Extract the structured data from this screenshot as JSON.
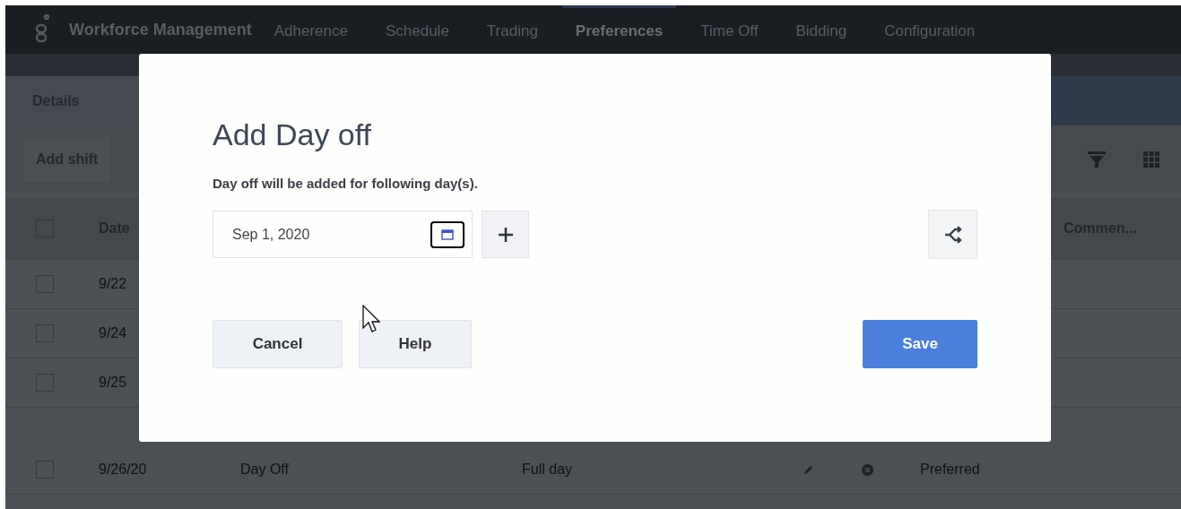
{
  "nav": {
    "app_title": "Workforce Management",
    "tabs": [
      {
        "label": "Adherence",
        "selected": false
      },
      {
        "label": "Schedule",
        "selected": false
      },
      {
        "label": "Trading",
        "selected": false
      },
      {
        "label": "Preferences",
        "selected": true
      },
      {
        "label": "Time Off",
        "selected": false
      },
      {
        "label": "Bidding",
        "selected": false
      },
      {
        "label": "Configuration",
        "selected": false
      }
    ]
  },
  "details_tab": "Details",
  "toolbar": {
    "add_shift": "Add shift"
  },
  "table": {
    "header_checked": false,
    "columns": [
      "Date",
      "Commen..."
    ],
    "rows": [
      {
        "date": "9/22",
        "checked": false
      },
      {
        "date": "9/24",
        "checked": false
      },
      {
        "date": "9/25",
        "checked": false
      },
      {
        "date": "9/26/20",
        "type": "Day Off",
        "duration": "Full day",
        "preference": "Preferred",
        "checked": false
      }
    ]
  },
  "dialog": {
    "title": "Add Day off",
    "message": "Day off will be added for following day(s).",
    "date_value": "Sep 1, 2020",
    "buttons": [
      {
        "label": "Cancel",
        "kind": "secondary"
      },
      {
        "label": "Help",
        "kind": "secondary"
      },
      {
        "label": "Save",
        "kind": "primary"
      }
    ]
  }
}
